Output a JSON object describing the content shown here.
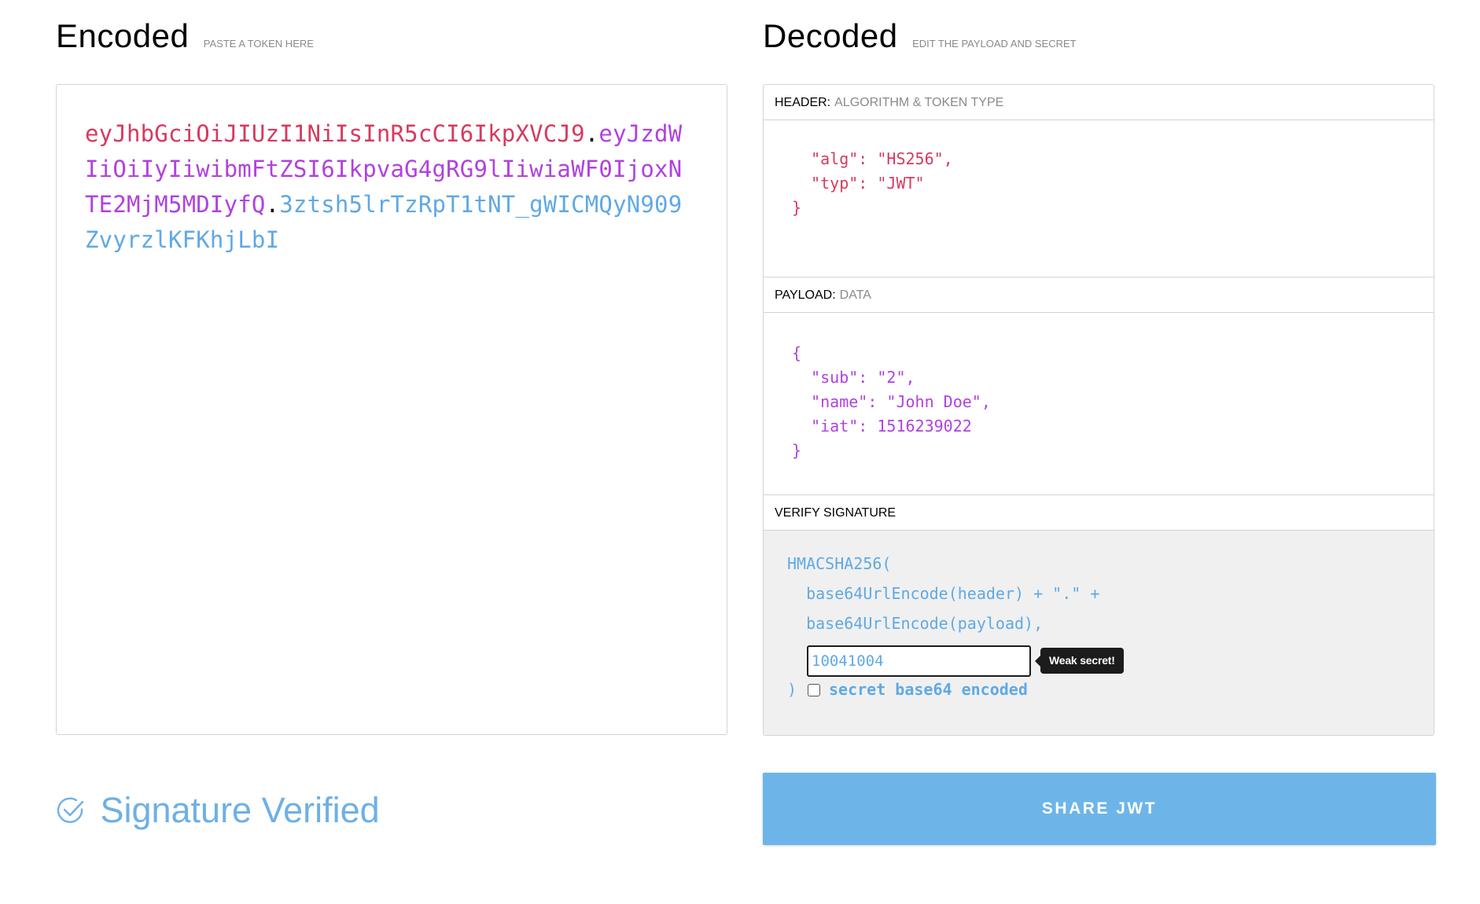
{
  "encoded": {
    "title": "Encoded",
    "subtitle": "PASTE A TOKEN HERE",
    "token": {
      "header": "eyJhbGciOiJIUzI1NiIsInR5cCI6IkpXVCJ9",
      "dot1": ".",
      "payload": "eyJzdWIiOiIyIiwibmFtZSI6IkpvaG4gRG9lIiwiaWF0IjoxNTE2MjM5MDIyfQ",
      "dot2": ".",
      "signature": "3ztsh5lrTzRpT1tNT_gWICMQyN909ZvyrzlKFKhjLbI"
    }
  },
  "decoded": {
    "title": "Decoded",
    "subtitle": "EDIT THE PAYLOAD AND SECRET",
    "header_section": {
      "label": "HEADER:",
      "desc": "ALGORITHM & TOKEN TYPE",
      "json_lines": [
        "  \"alg\": \"HS256\",",
        "  \"typ\": \"JWT\"",
        "}"
      ]
    },
    "payload_section": {
      "label": "PAYLOAD:",
      "desc": "DATA",
      "json_lines": [
        "{",
        "  \"sub\": \"2\",",
        "  \"name\": \"John Doe\",",
        "  \"iat\": 1516239022",
        "}"
      ]
    },
    "verify_section": {
      "label": "VERIFY SIGNATURE",
      "line1": "HMACSHA256(",
      "line2": "  base64UrlEncode(header) + \".\" +",
      "line3": "  base64UrlEncode(payload),",
      "secret_value": "10041004",
      "tooltip": "Weak secret!",
      "closing": ")",
      "checkbox_label": "secret base64 encoded",
      "checkbox_checked": false
    }
  },
  "status": {
    "verified_text": "Signature Verified",
    "icon": "check-circle-icon"
  },
  "share_button": "SHARE JWT",
  "colors": {
    "header": "#d63a5e",
    "payload": "#b141e0",
    "signature": "#5fa9e5",
    "share_button_bg": "#6db5e9"
  }
}
